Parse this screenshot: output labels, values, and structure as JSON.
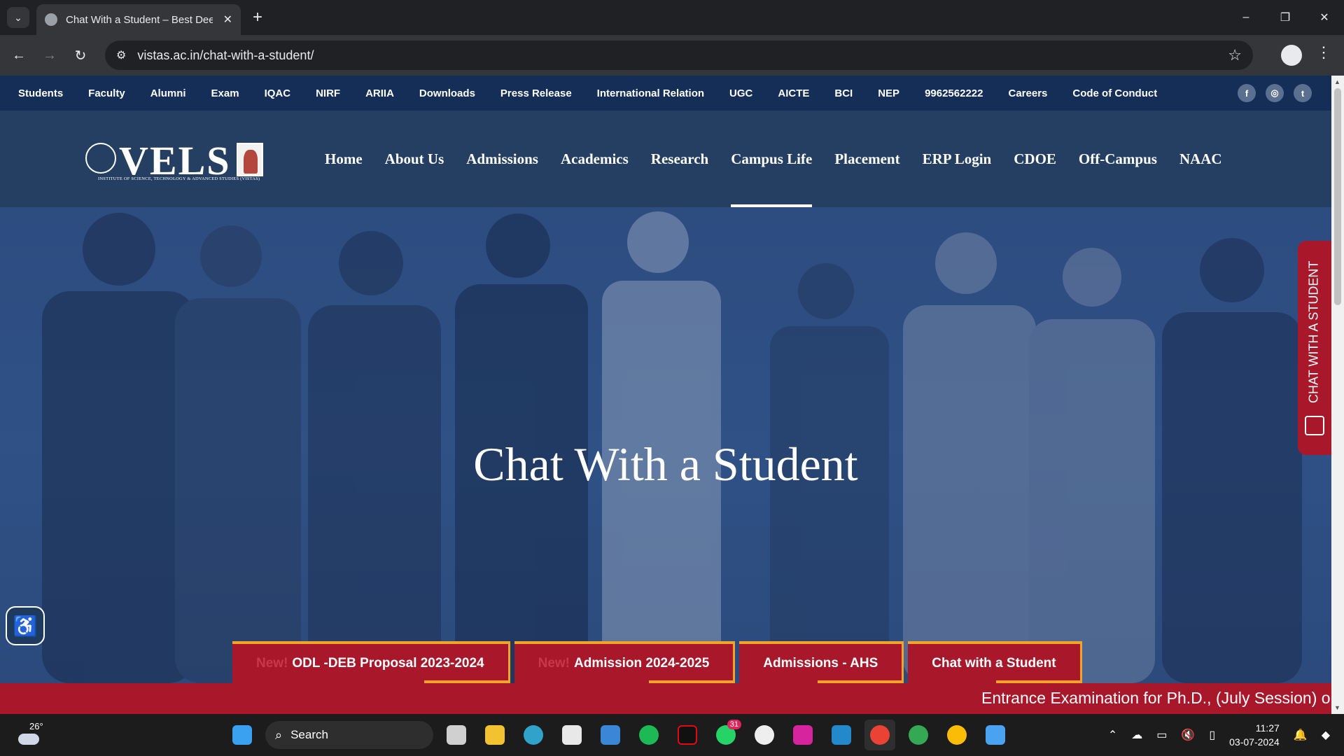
{
  "browser": {
    "tab_title": "Chat With a Student – Best Deemed",
    "tab_close": "✕",
    "new_tab": "+",
    "url": "vistas.ac.in/chat-with-a-student/",
    "window_controls": [
      "–",
      "❐",
      "✕"
    ]
  },
  "topbar": {
    "links": [
      "Students",
      "Faculty",
      "Alumni",
      "Exam",
      "IQAC",
      "NIRF",
      "ARIIA",
      "Downloads",
      "Press Release",
      "International Relation",
      "UGC",
      "AICTE",
      "BCI",
      "NEP",
      "9962562222",
      "Careers",
      "Code of Conduct"
    ],
    "socials": [
      "f",
      "◎",
      "t"
    ]
  },
  "header": {
    "logo_text": "VELS",
    "logo_tagline": "INSTITUTE OF SCIENCE, TECHNOLOGY & ADVANCED STUDIES (VISTAS)",
    "nav": [
      "Home",
      "About Us",
      "Admissions",
      "Academics",
      "Research",
      "Campus Life",
      "Placement",
      "ERP Login",
      "CDOE",
      "Off-Campus",
      "NAAC"
    ],
    "active_nav": "Campus Life"
  },
  "hero": {
    "title": "Chat With a Student"
  },
  "quick_links": [
    {
      "new": "New!",
      "label": "ODL -DEB Proposal 2023-2024"
    },
    {
      "new": "New!",
      "label": "Admission 2024-2025"
    },
    {
      "new": "",
      "label": "Admissions - AHS"
    },
    {
      "new": "",
      "label": "Chat with a Student"
    }
  ],
  "ticker": {
    "text": "Entrance Examination for Ph.D., (July Session) on"
  },
  "side_tab": {
    "label": "CHAT WITH A STUDENT"
  },
  "taskbar": {
    "temperature": "26°",
    "search_label": "Search",
    "whatsapp_badge": "31",
    "time": "11:27",
    "date": "03-07-2024"
  },
  "colors": {
    "topbar": "#142e58",
    "header": "#243f62",
    "accent_red": "#a8182a",
    "accent_gold": "#f0a52a"
  }
}
